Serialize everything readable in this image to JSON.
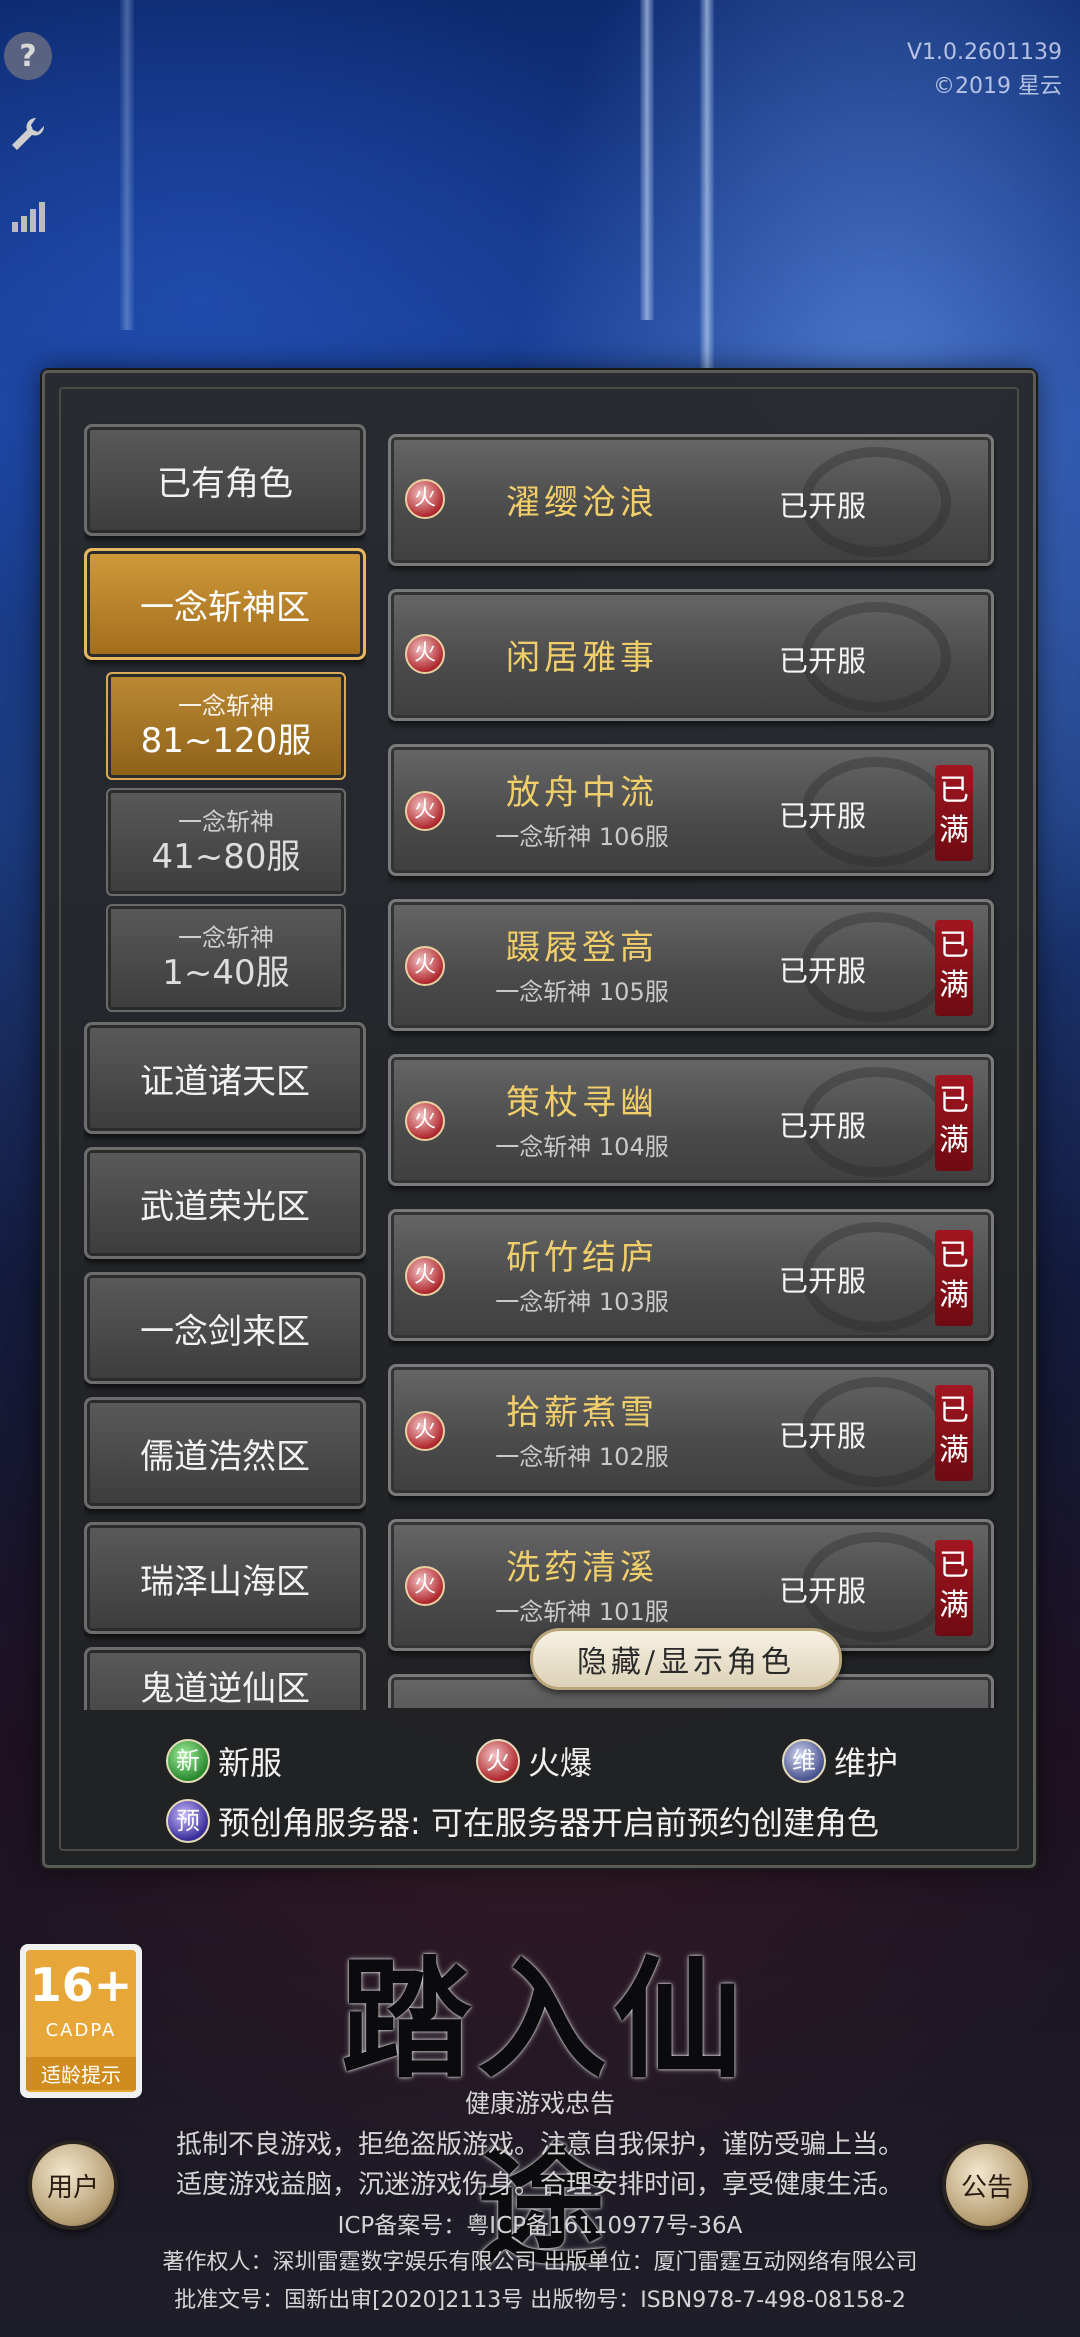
{
  "header": {
    "version": "V1.0.2601139",
    "copyright": "©2019 星云"
  },
  "top_icons": [
    "help-icon",
    "wrench-icon",
    "signal-icon"
  ],
  "zones": [
    {
      "label": "已有角色",
      "active": false
    },
    {
      "label": "一念斩神区",
      "active": true
    },
    {
      "label": "证道诸天区",
      "active": false
    },
    {
      "label": "武道荣光区",
      "active": false
    },
    {
      "label": "一念剑来区",
      "active": false
    },
    {
      "label": "儒道浩然区",
      "active": false
    },
    {
      "label": "瑞泽山海区",
      "active": false
    },
    {
      "label": "鬼道逆仙区",
      "active": false
    }
  ],
  "subzones": [
    {
      "group": "一念斩神",
      "range": "81~120服",
      "active": true
    },
    {
      "group": "一念斩神",
      "range": "41~80服",
      "active": false
    },
    {
      "group": "一念斩神",
      "range": "1~40服",
      "active": false
    }
  ],
  "servers": [
    {
      "name": "濯缨沧浪",
      "sub": "",
      "status": "已开服",
      "badge": "火",
      "full": ""
    },
    {
      "name": "闲居雅事",
      "sub": "",
      "status": "已开服",
      "badge": "火",
      "full": ""
    },
    {
      "name": "放舟中流",
      "sub": "一念斩神 106服",
      "status": "已开服",
      "badge": "火",
      "full": "已满"
    },
    {
      "name": "蹑屐登高",
      "sub": "一念斩神 105服",
      "status": "已开服",
      "badge": "火",
      "full": "已满"
    },
    {
      "name": "策杖寻幽",
      "sub": "一念斩神 104服",
      "status": "已开服",
      "badge": "火",
      "full": "已满"
    },
    {
      "name": "斫竹结庐",
      "sub": "一念斩神 103服",
      "status": "已开服",
      "badge": "火",
      "full": "已满"
    },
    {
      "name": "拾薪煮雪",
      "sub": "一念斩神 102服",
      "status": "已开服",
      "badge": "火",
      "full": "已满"
    },
    {
      "name": "洗药清溪",
      "sub": "一念斩神 101服",
      "status": "已开服",
      "badge": "火",
      "full": "已满"
    }
  ],
  "toggle_roles_label": "隐藏/显示角色",
  "legend": {
    "new_icon": "新",
    "new_label": "新服",
    "fire_icon": "火",
    "fire_label": "火爆",
    "maint_icon": "维",
    "maint_label": "维护",
    "pre_icon": "预",
    "pre_label": "预创角服务器: 可在服务器开启前预约创建角色"
  },
  "age_rating": {
    "age": "16+",
    "org": "CADPA",
    "tip": "适龄提示"
  },
  "game_title": "踏入仙途",
  "side_buttons": {
    "left": "用户",
    "right": "公告"
  },
  "footer": {
    "health_title": "健康游戏忠告",
    "health_line1": "抵制不良游戏，拒绝盗版游戏。注意自我保护，谨防受骗上当。",
    "health_line2": "适度游戏益脑，沉迷游戏伤身。合理安排时间，享受健康生活。",
    "icp": "ICP备案号：粤ICP备16110977号-36A",
    "copyright_holder": "著作权人：深圳雷霆数字娱乐有限公司 出版单位：厦门雷霆互动网络有限公司",
    "approval": "批准文号：国新出审[2020]2113号 出版物号：ISBN978-7-498-08158-2"
  },
  "colors": {
    "accent_gold": "#d09a3a",
    "server_name": "#f0cf6a",
    "full_badge": "#a11620"
  }
}
